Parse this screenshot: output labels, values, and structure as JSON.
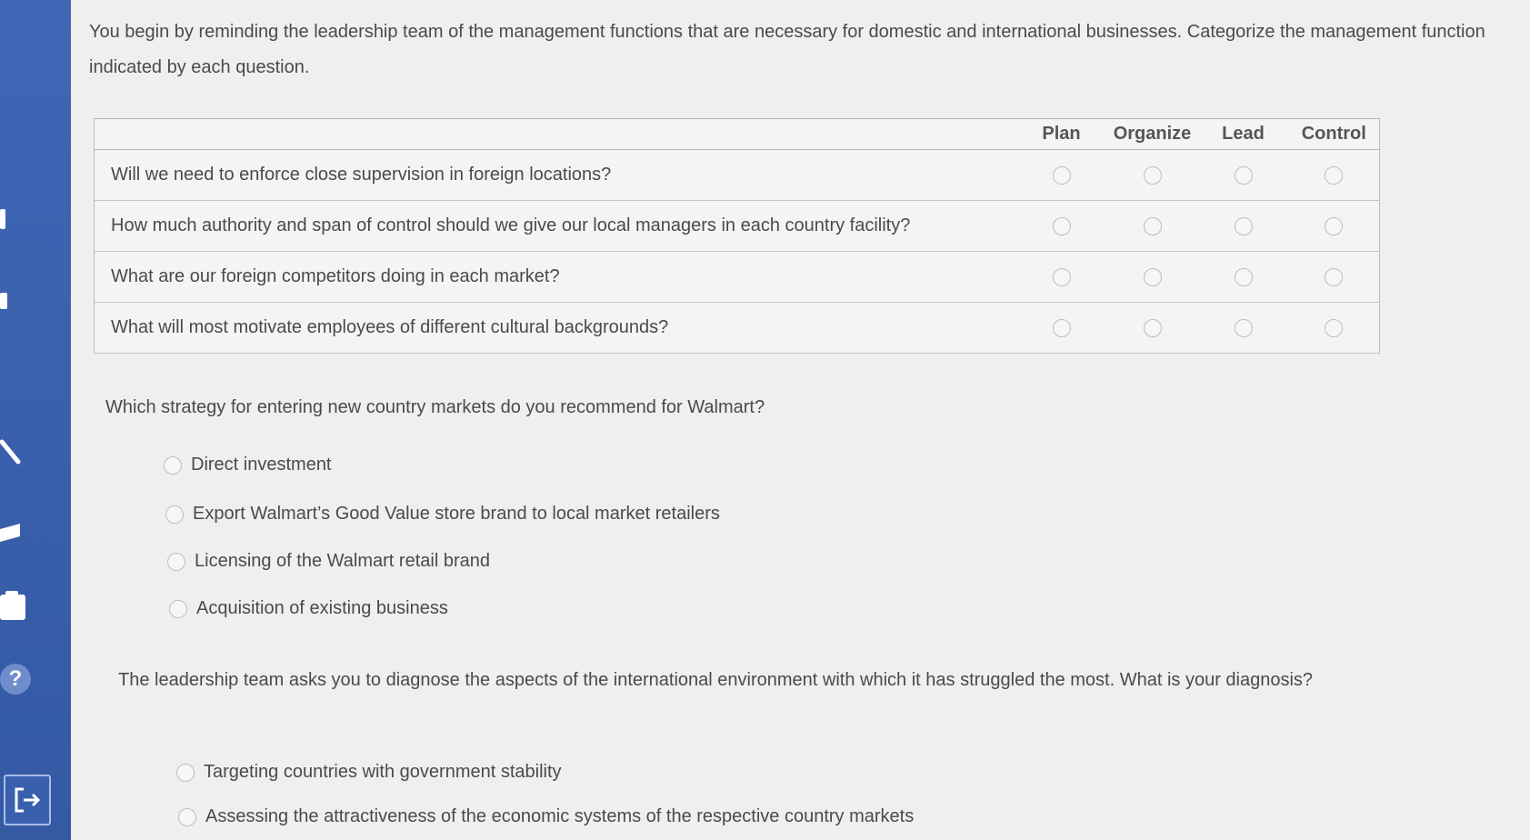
{
  "intro_text": "You begin by reminding the leadership team of the management functions that are necessary for domestic and international businesses. Categorize the management function indicated by each question.",
  "matrix": {
    "columns": [
      "Plan",
      "Organize",
      "Lead",
      "Control"
    ],
    "rows": [
      {
        "question": "Will we need to enforce close supervision in foreign locations?"
      },
      {
        "question": "How much authority and span of control should we give our local managers in each country facility?"
      },
      {
        "question": "What are our foreign competitors doing in each market?"
      },
      {
        "question": "What will most motivate employees of different cultural backgrounds?"
      }
    ]
  },
  "strategy": {
    "question": "Which strategy for entering new country markets do you recommend for Walmart?",
    "options": [
      "Direct investment",
      "Export Walmart’s Good Value store brand to local market retailers",
      "Licensing of the Walmart retail brand",
      "Acquisition of existing business"
    ]
  },
  "diagnosis": {
    "question": "The leadership team asks you to diagnose the aspects of the international environment with which it has struggled the most. What is your diagnosis?",
    "options": [
      "Targeting countries with government stability",
      "Assessing the attractiveness of the economic systems of the respective country markets"
    ]
  },
  "sidebar": {
    "help_label": "?",
    "exit_icon": "exit-icon"
  },
  "colors": {
    "sidebar": "#3a60ad",
    "background": "#efefed"
  }
}
